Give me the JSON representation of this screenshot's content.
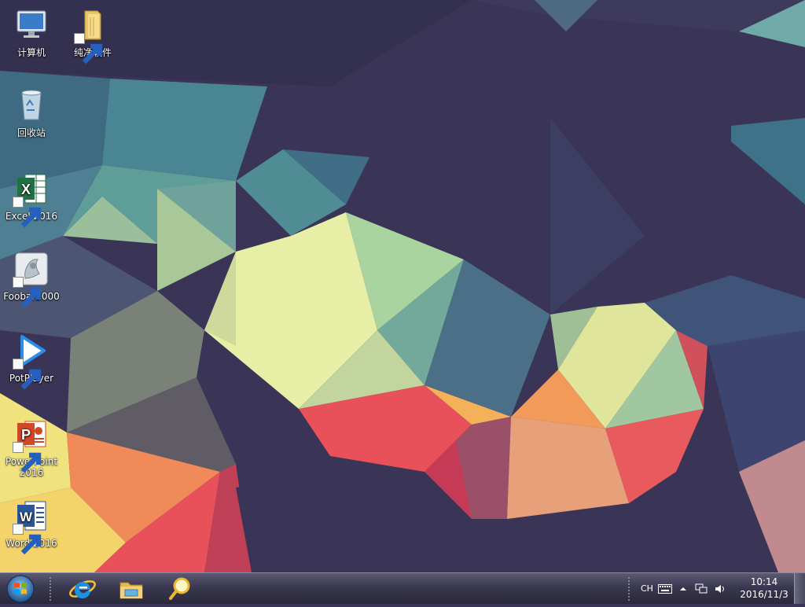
{
  "desktop": {
    "icons": [
      {
        "id": "computer",
        "label": "计算机",
        "icon": "computer-icon"
      },
      {
        "id": "pure-software",
        "label": "纯净软件",
        "icon": "folder-icon"
      },
      {
        "id": "recycle-bin",
        "label": "回收站",
        "icon": "recycle-bin-icon"
      },
      {
        "id": "excel",
        "label": "Excel 2016",
        "icon": "excel-icon"
      },
      {
        "id": "foobar",
        "label": "Foobar2000",
        "icon": "foobar-icon"
      },
      {
        "id": "potplayer",
        "label": "PotPlayer",
        "icon": "potplayer-icon"
      },
      {
        "id": "powerpoint",
        "label_line1": "PowerPoint",
        "label_line2": "2016",
        "icon": "powerpoint-icon"
      },
      {
        "id": "word",
        "label": "Word 2016",
        "icon": "word-icon"
      }
    ]
  },
  "taskbar": {
    "start_icon": "windows-logo-icon",
    "pinned": [
      {
        "id": "internet-explorer",
        "icon": "internet-explorer-icon"
      },
      {
        "id": "file-explorer",
        "icon": "file-explorer-icon"
      },
      {
        "id": "search",
        "icon": "magnifier-icon"
      }
    ],
    "tray": {
      "language": "CH",
      "clock_time": "10:14",
      "clock_date": "2016/11/3"
    }
  },
  "colors": {
    "taskbar": "#3a3850",
    "excel_green": "#1f7244",
    "powerpoint_orange": "#d24726",
    "word_blue": "#2b579a",
    "potplayer_blue": "#2a8ee8"
  }
}
